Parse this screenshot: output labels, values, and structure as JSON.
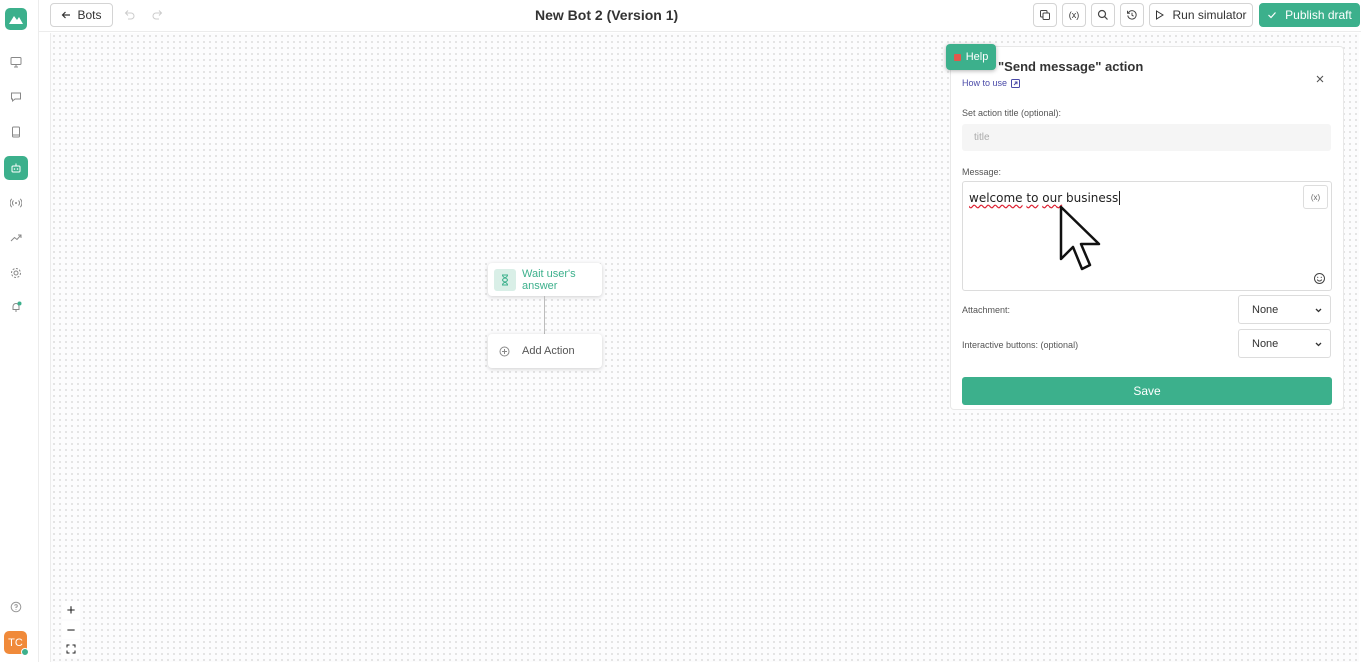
{
  "header": {
    "back_label": "Bots",
    "title": "New Bot 2 (Version 1)",
    "run_simulator_label": "Run simulator",
    "publish_label": "Publish draft"
  },
  "sidebar": {
    "icons": [
      "monitor-icon",
      "chat-icon",
      "book-icon",
      "bot-icon",
      "broadcast-icon",
      "trend-icon",
      "gear-icon",
      "bell-icon"
    ],
    "active": "bot-icon",
    "avatar_initials": "TC"
  },
  "canvas": {
    "wait_node_label": "Wait user's answer",
    "add_action_label": "Add Action",
    "zoom_in": "+",
    "zoom_out": "−"
  },
  "panel": {
    "help_label": "Help",
    "title": "\"Send message\" action",
    "how_to_use": "How to use",
    "action_title_label": "Set action title (optional):",
    "action_title_placeholder": "title",
    "message_label": "Message:",
    "message_words": [
      "welcome",
      "to",
      "our",
      "business"
    ],
    "variable_button": "(x)",
    "attachment_label": "Attachment:",
    "attachment_value": "None",
    "interactive_label": "Interactive buttons: (optional)",
    "interactive_value": "None",
    "save_label": "Save"
  },
  "colors": {
    "accent": "#3cb08c",
    "link": "#4a4aa8"
  }
}
